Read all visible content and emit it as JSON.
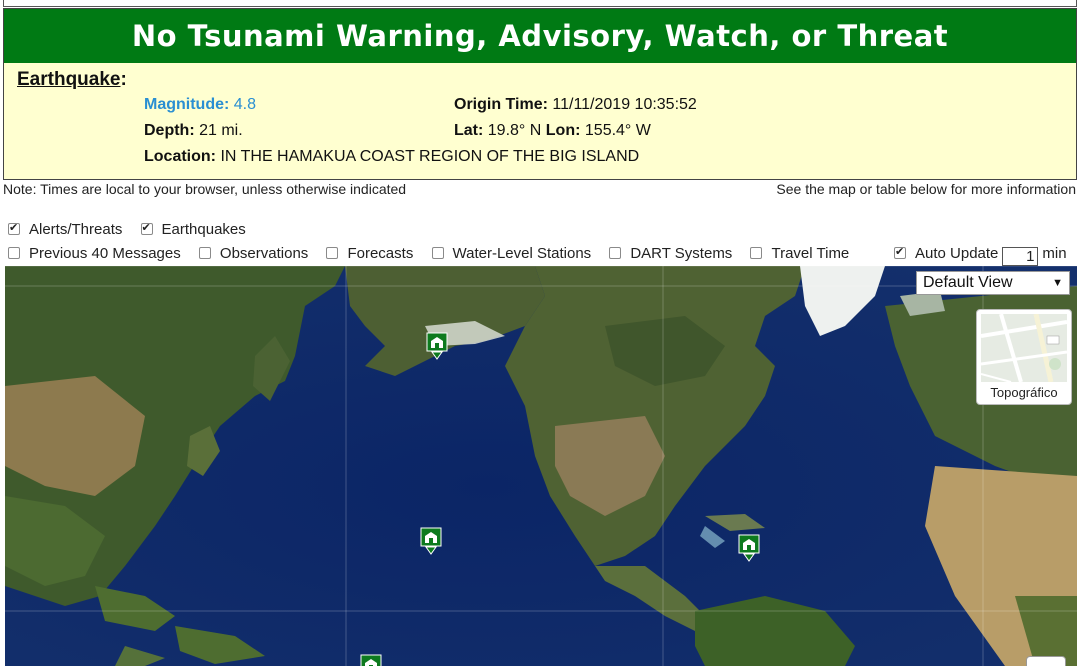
{
  "banner": {
    "title": "No Tsunami Warning, Advisory, Watch, or Threat",
    "bg_color": "#007a14"
  },
  "earthquake": {
    "heading": "Earthquake",
    "heading_suffix": ":",
    "magnitude_label": "Magnitude:",
    "magnitude_value": "4.8",
    "origin_time_label": "Origin Time:",
    "origin_time_value": "11/11/2019 10:35:52",
    "depth_label": "Depth:",
    "depth_value": "21 mi.",
    "lat_label": "Lat:",
    "lat_value": "19.8° N",
    "lon_label": "Lon:",
    "lon_value": "155.4° W",
    "location_label": "Location:",
    "location_value": "IN THE HAMAKUA COAST REGION OF THE BIG ISLAND"
  },
  "notes": {
    "left": "Note: Times are local to your browser, unless otherwise indicated",
    "right": "See the map or table below for more information"
  },
  "layers": {
    "row1": [
      {
        "label": "Alerts/Threats",
        "checked": true
      },
      {
        "label": "Earthquakes",
        "checked": true
      }
    ],
    "row2": [
      {
        "label": "Previous 40 Messages",
        "checked": false
      },
      {
        "label": "Observations",
        "checked": false
      },
      {
        "label": "Forecasts",
        "checked": false
      },
      {
        "label": "Water-Level Stations",
        "checked": false
      },
      {
        "label": "DART Systems",
        "checked": false
      },
      {
        "label": "Travel Time",
        "checked": false
      }
    ],
    "auto_update": {
      "label": "Auto Update",
      "value": "1",
      "unit": "min",
      "checked": true
    }
  },
  "map": {
    "view_select": "Default View",
    "basemap_toggle": "Topográfico",
    "marker_icon": "tsunami-center-icon",
    "marker_color": "#0d7a1e",
    "zoom_icon": "zoom-in-icon"
  }
}
